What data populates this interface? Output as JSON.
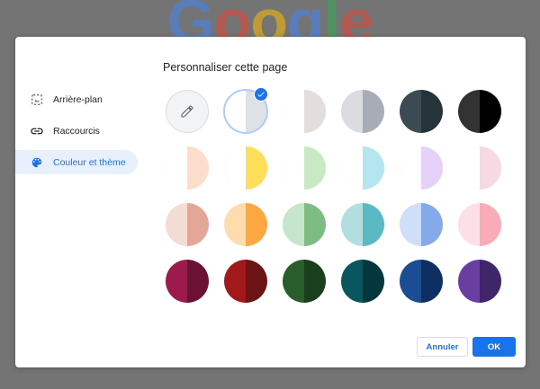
{
  "background": {
    "logo_letters": [
      {
        "ch": "G",
        "color": "#4285f4"
      },
      {
        "ch": "o",
        "color": "#ea4335"
      },
      {
        "ch": "o",
        "color": "#fbbc05"
      },
      {
        "ch": "g",
        "color": "#4285f4"
      },
      {
        "ch": "l",
        "color": "#34a853"
      },
      {
        "ch": "e",
        "color": "#ea4335"
      }
    ]
  },
  "dialog": {
    "title": "Personnaliser cette page",
    "nav": [
      {
        "label": "Arrière-plan",
        "icon": "image-icon",
        "active": false
      },
      {
        "label": "Raccourcis",
        "icon": "link-icon",
        "active": false
      },
      {
        "label": "Couleur et thème",
        "icon": "palette-icon",
        "active": true
      }
    ],
    "swatches": [
      {
        "name": "custom-color",
        "left": "#f1f3f4",
        "right": "#f1f3f4",
        "custom": true
      },
      {
        "name": "default",
        "left": "#ffffff",
        "right": "#dee1e6",
        "selected": true
      },
      {
        "name": "warm-grey",
        "left": "#ffffff",
        "right": "#e3dedb"
      },
      {
        "name": "cool-grey",
        "left": "#dadce0",
        "right": "#a8acb6"
      },
      {
        "name": "midnight-blue",
        "left": "#3c4a54",
        "right": "#27333b"
      },
      {
        "name": "black",
        "left": "#333333",
        "right": "#000000"
      },
      {
        "name": "beige-white",
        "left": "#ffffff",
        "right": "#fcdcca"
      },
      {
        "name": "yellow-white",
        "left": "#ffffff",
        "right": "#ffde5c"
      },
      {
        "name": "green-white",
        "left": "#ffffff",
        "right": "#c9e9c4"
      },
      {
        "name": "light-teal-white",
        "left": "#ffffff",
        "right": "#b5e5ee"
      },
      {
        "name": "light-purple-white",
        "left": "#ffffff",
        "right": "#e6d1fb"
      },
      {
        "name": "pink-white",
        "left": "#ffffff",
        "right": "#f7d9e4"
      },
      {
        "name": "peach",
        "left": "#f2dcd3",
        "right": "#e2a797"
      },
      {
        "name": "orange",
        "left": "#ffdcae",
        "right": "#ffa843"
      },
      {
        "name": "light-green",
        "left": "#c6e6cc",
        "right": "#7ebc84"
      },
      {
        "name": "light-teal",
        "left": "#b2dee0",
        "right": "#5ab9c3"
      },
      {
        "name": "light-blue",
        "left": "#cfdef9",
        "right": "#86aae9"
      },
      {
        "name": "light-pink",
        "left": "#fde0e5",
        "right": "#fbabb8"
      },
      {
        "name": "dark-pink-red",
        "left": "#9c1a4d",
        "right": "#6b1132"
      },
      {
        "name": "dark-red-orange",
        "left": "#a2191b",
        "right": "#6c1416"
      },
      {
        "name": "dark-green",
        "left": "#2a5d2c",
        "right": "#1a3f1c"
      },
      {
        "name": "dark-teal",
        "left": "#0a565f",
        "right": "#04363d"
      },
      {
        "name": "dark-blue",
        "left": "#1a4d94",
        "right": "#0d2f63"
      },
      {
        "name": "purple",
        "left": "#6a3ea1",
        "right": "#3e2669"
      }
    ],
    "cancel_label": "Annuler",
    "ok_label": "OK"
  },
  "colors": {
    "accent": "#1a73e8",
    "nav_active_bg": "#e8f0fe",
    "overlay": "#747474"
  }
}
